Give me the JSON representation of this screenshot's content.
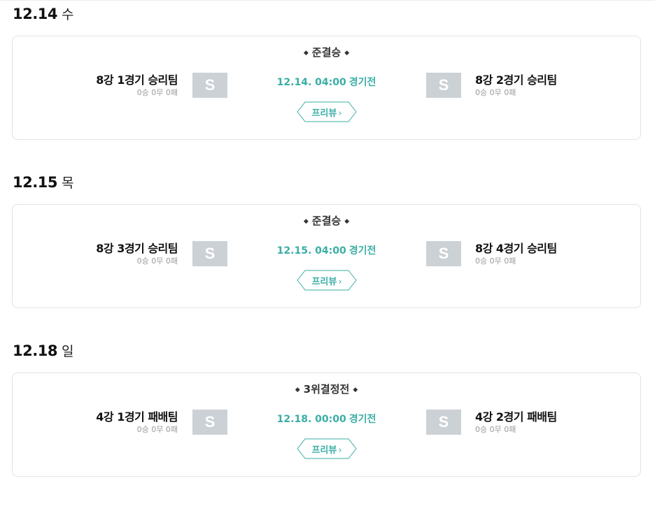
{
  "days": [
    {
      "date": "12.14",
      "dow": "수",
      "match": {
        "round": "준결승",
        "home": {
          "name": "8강 1경기 승리팀",
          "record": "0승 0무 0패",
          "logo": "S"
        },
        "away": {
          "name": "8강 2경기 승리팀",
          "record": "0승 0무 0패",
          "logo": "S"
        },
        "time": "12.14. 04:00",
        "status": "경기전",
        "preview_label": "프리뷰",
        "preview_chevron": "›"
      }
    },
    {
      "date": "12.15",
      "dow": "목",
      "match": {
        "round": "준결승",
        "home": {
          "name": "8강 3경기 승리팀",
          "record": "0승 0무 0패",
          "logo": "S"
        },
        "away": {
          "name": "8강 4경기 승리팀",
          "record": "0승 0무 0패",
          "logo": "S"
        },
        "time": "12.15. 04:00",
        "status": "경기전",
        "preview_label": "프리뷰",
        "preview_chevron": "›"
      }
    },
    {
      "date": "12.18",
      "dow": "일",
      "match": {
        "round": "3위결정전",
        "home": {
          "name": "4강 1경기 패배팀",
          "record": "0승 0무 0패",
          "logo": "S"
        },
        "away": {
          "name": "4강 2경기 패배팀",
          "record": "0승 0무 0패",
          "logo": "S"
        },
        "time": "12.18. 00:00",
        "status": "경기전",
        "preview_label": "프리뷰",
        "preview_chevron": "›"
      }
    }
  ],
  "decor": {
    "diamond_glyph": "◆"
  },
  "colors": {
    "accent": "#3aaea5",
    "logo_placeholder": "#ccd1d6",
    "card_border": "#e3e3e3",
    "record_text": "#9a9a9a"
  }
}
